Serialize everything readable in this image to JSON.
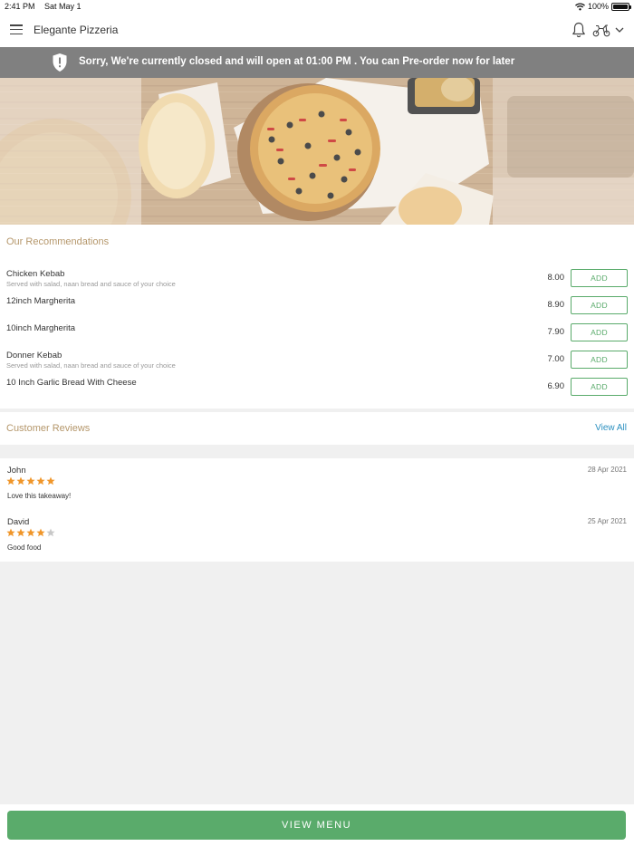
{
  "status_bar": {
    "time": "2:41 PM",
    "date": "Sat May 1",
    "battery": "100%"
  },
  "header": {
    "title": "Elegante Pizzeria",
    "icons": [
      "menu-icon",
      "bell-icon",
      "delivery-icon",
      "chevron-down-icon"
    ]
  },
  "banner": {
    "text": "Sorry, We're currently closed and will open at 01:00 PM . You can Pre-order now for later",
    "icon": "shield-icon"
  },
  "recommendations": {
    "title": "Our Recommendations",
    "add_label": "ADD",
    "items": [
      {
        "name": "Chicken Kebab",
        "description": "Served with salad, naan bread and sauce of your choice",
        "price": "8.00"
      },
      {
        "name": "12inch Margherita",
        "description": "",
        "price": "8.90"
      },
      {
        "name": "10inch Margherita",
        "description": "",
        "price": "7.90"
      },
      {
        "name": "Donner Kebab",
        "description": "Served with salad, naan bread and sauce of your choice",
        "price": "7.00"
      },
      {
        "name": "10 Inch Garlic Bread With Cheese",
        "description": "",
        "price": "6.90"
      }
    ]
  },
  "reviews": {
    "title": "Customer Reviews",
    "view_all": "View All",
    "items": [
      {
        "name": "John",
        "date": "28 Apr 2021",
        "rating": 5,
        "max_rating": 5,
        "text": "Love this takeaway!"
      },
      {
        "name": "David",
        "date": "25 Apr 2021",
        "rating": 4,
        "max_rating": 5,
        "text": "Good food"
      }
    ]
  },
  "footer": {
    "button_label": "VIEW MENU"
  },
  "colors": {
    "accent_green": "#5aab6b",
    "section_title": "#b5976b",
    "link_blue": "#2a8fbf",
    "banner_grey": "#808080",
    "star_active": "#f0962a",
    "star_inactive": "#c8c8c8"
  }
}
